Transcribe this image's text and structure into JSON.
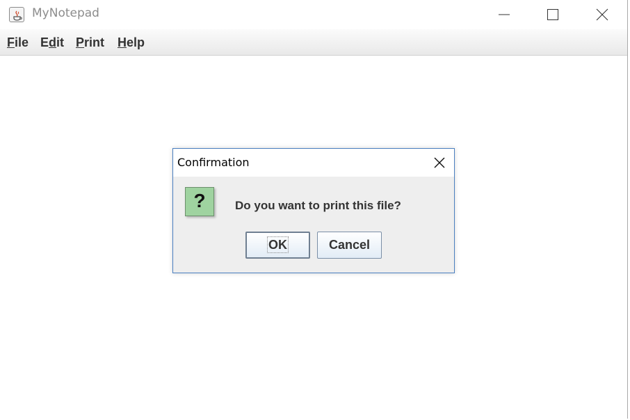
{
  "window": {
    "title": "MyNotepad",
    "icon": "java-cup-icon"
  },
  "menubar": {
    "items": [
      {
        "mnemonic": "F",
        "rest": "ile"
      },
      {
        "mnemonic": "",
        "pre": "E",
        "mn": "d",
        "post": "it"
      },
      {
        "mnemonic": "P",
        "rest": "rint"
      },
      {
        "mnemonic": "H",
        "rest": "elp"
      }
    ]
  },
  "dialog": {
    "title": "Confirmation",
    "icon": "question-icon",
    "icon_glyph": "?",
    "message": "Do you want to print this file?",
    "ok_label": "OK",
    "cancel_label": "Cancel"
  },
  "colors": {
    "dialog_border": "#4a7fc0",
    "question_bg": "#9fd3a0",
    "menubar_bg": "#f0f0f0"
  }
}
